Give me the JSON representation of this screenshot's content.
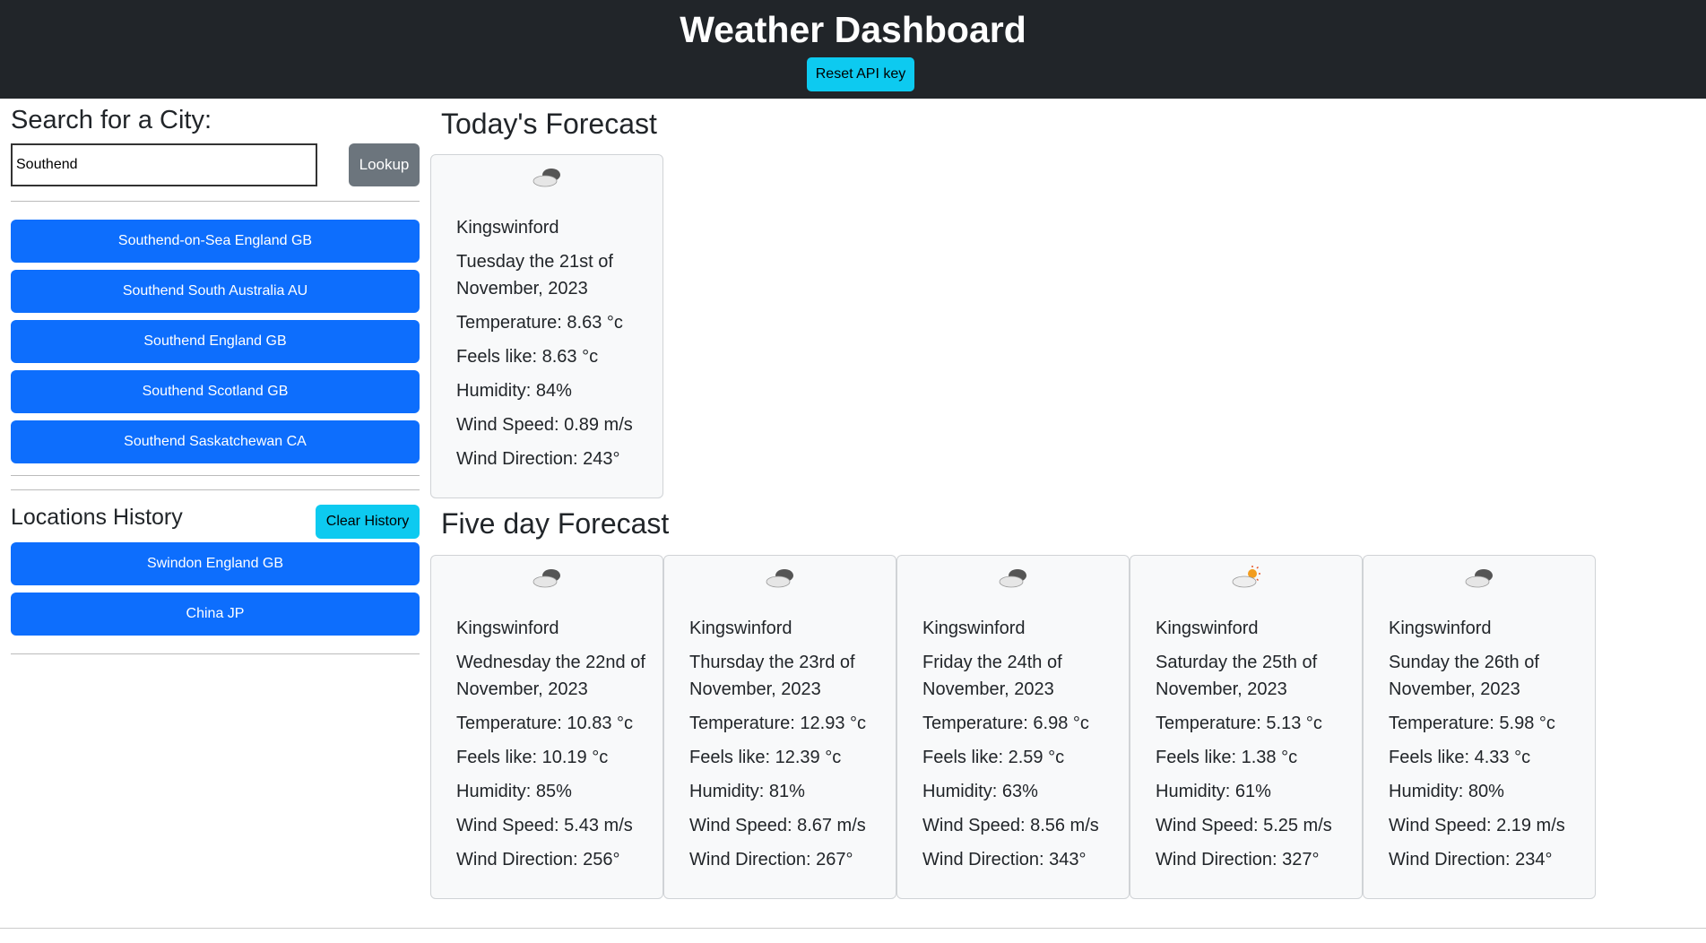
{
  "header": {
    "title": "Weather Dashboard",
    "reset_label": "Reset API key"
  },
  "search": {
    "title": "Search for a City:",
    "value": "Southend",
    "lookup_label": "Lookup"
  },
  "results": [
    "Southend-on-Sea England GB",
    "Southend South Australia AU",
    "Southend England GB",
    "Southend Scotland GB",
    "Southend Saskatchewan CA"
  ],
  "history": {
    "title": "Locations History",
    "clear_label": "Clear History",
    "items": [
      "Swindon England GB",
      "China JP"
    ]
  },
  "today": {
    "title": "Today's Forecast",
    "card": {
      "icon": "cloudy-icon",
      "city": "Kingswinford",
      "date": "Tuesday the 21st of November, 2023",
      "temp": "Temperature: 8.63 °c",
      "feels": "Feels like: 8.63 °c",
      "humidity": "Humidity: 84%",
      "wind_speed": "Wind Speed: 0.89 m/s",
      "wind_dir": "Wind Direction: 243°"
    }
  },
  "five_day": {
    "title": "Five day Forecast",
    "cards": [
      {
        "icon": "cloudy-icon",
        "city": "Kingswinford",
        "date": "Wednesday the 22nd of November, 2023",
        "temp": "Temperature: 10.83 °c",
        "feels": "Feels like: 10.19 °c",
        "humidity": "Humidity: 85%",
        "wind_speed": "Wind Speed: 5.43 m/s",
        "wind_dir": "Wind Direction: 256°"
      },
      {
        "icon": "cloudy-icon",
        "city": "Kingswinford",
        "date": "Thursday the 23rd of November, 2023",
        "temp": "Temperature: 12.93 °c",
        "feels": "Feels like: 12.39 °c",
        "humidity": "Humidity: 81%",
        "wind_speed": "Wind Speed: 8.67 m/s",
        "wind_dir": "Wind Direction: 267°"
      },
      {
        "icon": "cloudy-icon",
        "city": "Kingswinford",
        "date": "Friday the 24th of November, 2023",
        "temp": "Temperature: 6.98 °c",
        "feels": "Feels like: 2.59 °c",
        "humidity": "Humidity: 63%",
        "wind_speed": "Wind Speed: 8.56 m/s",
        "wind_dir": "Wind Direction: 343°"
      },
      {
        "icon": "partly-sunny-icon",
        "city": "Kingswinford",
        "date": "Saturday the 25th of November, 2023",
        "temp": "Temperature: 5.13 °c",
        "feels": "Feels like: 1.38 °c",
        "humidity": "Humidity: 61%",
        "wind_speed": "Wind Speed: 5.25 m/s",
        "wind_dir": "Wind Direction: 327°"
      },
      {
        "icon": "cloudy-icon",
        "city": "Kingswinford",
        "date": "Sunday the 26th of November, 2023",
        "temp": "Temperature: 5.98 °c",
        "feels": "Feels like: 4.33 °c",
        "humidity": "Humidity: 80%",
        "wind_speed": "Wind Speed: 2.19 m/s",
        "wind_dir": "Wind Direction: 234°"
      }
    ]
  }
}
